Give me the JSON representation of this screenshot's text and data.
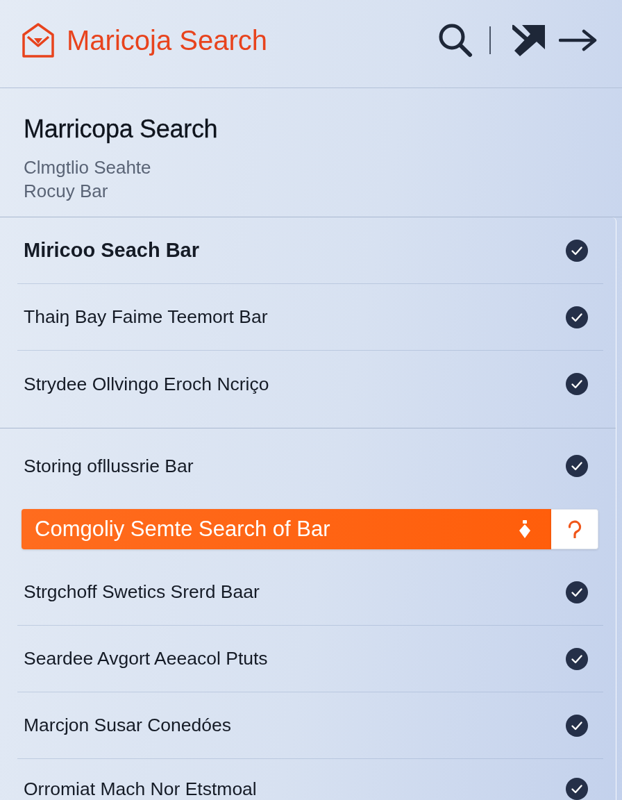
{
  "header": {
    "title": "Maricoja Search"
  },
  "intro": {
    "title": "Marricopa Search",
    "subtitle": "Clmgtlio Seahte Rocuy Bar"
  },
  "sections": [
    {
      "items": [
        {
          "label": "Miricoo Seach Bar",
          "emphasized": true,
          "checked": true,
          "selected": false
        },
        {
          "label": "Thaiŋ Bay Faime Teemort Bar",
          "emphasized": false,
          "checked": true,
          "selected": false
        },
        {
          "label": "Strydee Ollvingo Eroch Ncriço",
          "emphasized": false,
          "checked": true,
          "selected": false
        }
      ]
    },
    {
      "items": [
        {
          "label": "Storing ofllussrie Bar",
          "emphasized": false,
          "checked": true,
          "selected": false
        },
        {
          "label": "Comgoliy Semte Search of Bar",
          "emphasized": false,
          "checked": false,
          "selected": true
        },
        {
          "label": "Strgchoff Swetics Srerd Baar",
          "emphasized": false,
          "checked": true,
          "selected": false
        },
        {
          "label": "Seardee Avgort Aeeacol Ptuts",
          "emphasized": false,
          "checked": true,
          "selected": false
        },
        {
          "label": "Marcjon Susar Conedóes",
          "emphasized": false,
          "checked": true,
          "selected": false
        },
        {
          "label": "Orromiat Mach Nor Etstmoal",
          "emphasized": false,
          "checked": true,
          "selected": false
        }
      ]
    }
  ]
}
